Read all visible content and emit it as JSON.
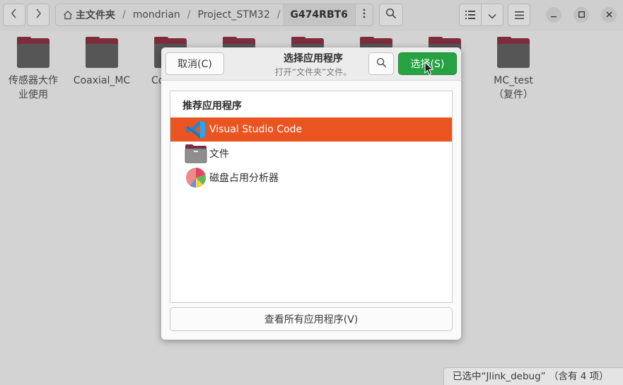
{
  "filemanager": {
    "breadcrumbs": [
      "主文件夹",
      "mondrian",
      "Project_STM32",
      "G474RBT6"
    ],
    "icons": {
      "back": "chevron-left-icon",
      "forward": "chevron-right-icon",
      "home": "home-icon",
      "menu": "more-vertical-icon",
      "search": "search-icon",
      "view_list": "list-view-icon",
      "view_toggle": "chevron-down-icon",
      "hamburger": "hamburger-menu-icon"
    },
    "items": [
      {
        "label": "传感器大作业使用"
      },
      {
        "label": "Coaxial_MC"
      },
      {
        "label": "Co"
      },
      {
        "label": ""
      },
      {
        "label": ""
      },
      {
        "label": ""
      },
      {
        "label": ""
      },
      {
        "label": "MC_test\n（复件）"
      }
    ],
    "status": "已选中“Jlink_debug” （含有 4 项）"
  },
  "dialog": {
    "title": "选择应用程序",
    "subtitle": "打开“文件夹”文件。",
    "cancel_label": "取消(C)",
    "select_label": "选择(S)",
    "list_header": "推荐应用程序",
    "apps": [
      {
        "name": "Visual Studio Code",
        "icon": "vscode-icon",
        "selected": true
      },
      {
        "name": "文件",
        "icon": "files-icon",
        "selected": false
      },
      {
        "name": "磁盘占用分析器",
        "icon": "disk-usage-analyzer-icon",
        "selected": false
      }
    ],
    "show_all_label": "查看所有应用程序(V)"
  },
  "colors": {
    "accent_selected": "#e95420",
    "select_button": "#26a243",
    "folder_tab": "#7d2c3d",
    "folder_body": "#565656"
  }
}
